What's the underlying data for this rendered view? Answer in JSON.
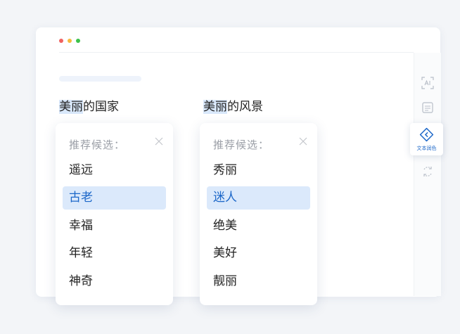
{
  "window": {
    "traffic_lights": [
      "#f0625f",
      "#f6bb3f",
      "#3cc24b"
    ]
  },
  "sentences": [
    {
      "highlight": "美丽",
      "rest": "的国家"
    },
    {
      "highlight": "美丽",
      "rest": "的风景"
    }
  ],
  "panels": [
    {
      "header": "推荐候选：",
      "candidates": [
        "遥远",
        "古老",
        "幸福",
        "年轻",
        "神奇"
      ],
      "selected_index": 1
    },
    {
      "header": "推荐候选：",
      "candidates": [
        "秀丽",
        "迷人",
        "绝美",
        "美好",
        "靓丽"
      ],
      "selected_index": 1
    }
  ],
  "sidebar": {
    "items": [
      {
        "icon": "ai-icon"
      },
      {
        "icon": "document-icon"
      },
      {
        "icon": "polish-icon",
        "label": "文本润色",
        "active": true
      },
      {
        "icon": "rewrite-icon"
      }
    ]
  },
  "colors": {
    "accent": "#1d68c9",
    "highlight": "#d9e8fb",
    "selected_bg": "#dbe9fb"
  }
}
